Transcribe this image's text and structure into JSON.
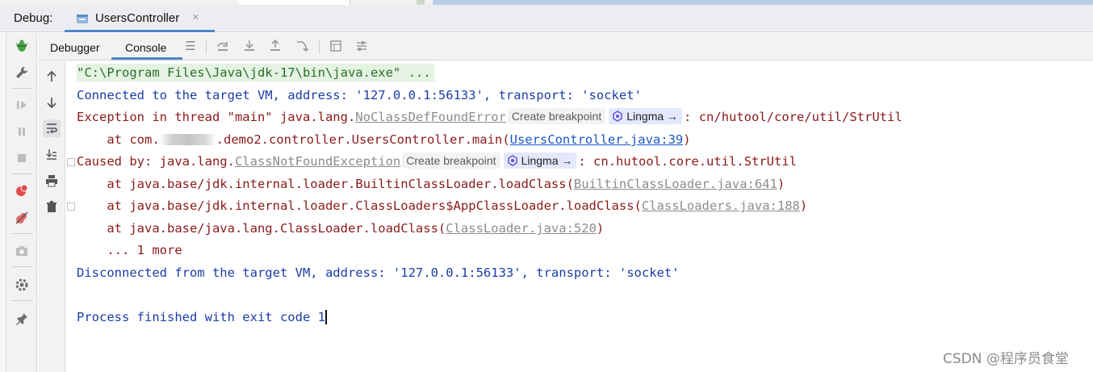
{
  "debug_bar": {
    "label": "Debug:",
    "session_tab": {
      "label": "UsersController",
      "close": "×"
    }
  },
  "sub_tabs": [
    {
      "label": "Debugger"
    },
    {
      "label": "Console"
    }
  ],
  "console": {
    "lines": {
      "cmd": "\"C:\\Program Files\\Java\\jdk-17\\bin\\java.exe\" ...",
      "connected": "Connected to the target VM, address: '127.0.0.1:56133', transport: 'socket'",
      "exc_prefix": "Exception in thread \"main\" java.lang.",
      "exc_class": "NoClassDefFoundError",
      "exc_suffix": ": cn/hutool/core/util/StrUtil",
      "at1_prefix": "    at com.",
      "at1_mid": ".demo2.controller.UsersController.main(",
      "at1_link": "UsersController.java:39",
      "at1_suffix": ")",
      "caused_prefix": "Caused by: java.lang.",
      "caused_class": "ClassNotFoundException",
      "caused_suffix": ": cn.hutool.core.util.StrUtil",
      "at2_prefix": "    at java.base/jdk.internal.loader.BuiltinClassLoader.loadClass(",
      "at2_link": "BuiltinClassLoader.java:641",
      "at2_suffix": ")",
      "at3_prefix": "    at java.base/jdk.internal.loader.ClassLoaders$AppClassLoader.loadClass(",
      "at3_link": "ClassLoaders.java:188",
      "at3_suffix": ")",
      "at4_prefix": "    at java.base/java.lang.ClassLoader.loadClass(",
      "at4_link": "ClassLoader.java:520",
      "at4_suffix": ")",
      "more": "    ... 1 more",
      "disconnected": "Disconnected from the target VM, address: '127.0.0.1:56133', transport: 'socket'",
      "finished": "Process finished with exit code 1"
    },
    "chips": {
      "create_breakpoint": "Create breakpoint",
      "lingma": "Lingma",
      "arrow": "→"
    }
  },
  "watermark": "CSDN @程序员食堂",
  "colors": {
    "accent": "#4a88c7",
    "console_blue": "#1b3da6",
    "console_red": "#8b1a1a",
    "link_blue": "#1a56c7",
    "cmd_bg": "#e4f3e2"
  }
}
